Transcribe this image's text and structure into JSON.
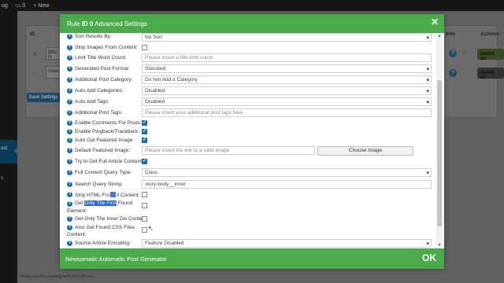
{
  "adminbar": {
    "left_label": "og",
    "comments_count": "0",
    "new_label": "+ New"
  },
  "sidebar": {
    "active_label": "ost",
    "second_label": "s"
  },
  "background": {
    "col_id": "ID",
    "col_info": "Info",
    "col_actions": "Actions",
    "row1_id": "0",
    "row1_value": "BBC N",
    "row2_id": "-",
    "row2_value": "Selec",
    "save_button": "Save Settings",
    "select_button_1": "Select an",
    "select_button_2": "Select an",
    "footer_text": "Thank you for creating with WordPress."
  },
  "modal": {
    "title_prefix": "Rule",
    "title_id": "ID 0",
    "title_suffix": "Advanced Settings",
    "close_icon": "close-icon",
    "footer_title": "Newsomatic Automatic Post Generator",
    "ok_label": "OK",
    "help_glyph": "?"
  },
  "fields": {
    "sort_results_label": "Sort Results By:",
    "sort_results_value": "No Sort",
    "strip_images_label": "Strip Images From Content:",
    "limit_title_label": "Limit Title Word Count:",
    "limit_title_placeholder": "Please insert a title limit count",
    "post_format_label": "Generated Post Format:",
    "post_format_value": "Standard",
    "additional_category_label": "Additional Post Category:",
    "additional_category_value": "Do Not Add a Category",
    "auto_categories_label": "Auto Add Categories:",
    "auto_categories_value": "Disabled",
    "auto_tags_label": "Auto Add Tags:",
    "auto_tags_value": "Disabled",
    "additional_tags_label": "Additional Post Tags:",
    "additional_tags_placeholder": "Please insert your additional post tags here",
    "enable_comments_label": "Enable Comments For Posts:",
    "enable_pingback_label": "Enable Pingback/Trackback:",
    "featured_image_label": "Auto Get Featured Image:",
    "default_featured_label": "Default Featured Image:",
    "default_featured_placeholder": "Please insert the link to a valid image",
    "choose_image_button": "Choose image",
    "full_article_label": "Try to Get Full Article Content:",
    "query_type_label": "Full Content Query Type:",
    "query_type_value": "Class",
    "search_query_label": "Search Query String:",
    "search_query_value": "story-body__inner",
    "strip_html_label_a": "Strip HTML Fro",
    "strip_html_label_b": "ll Content:",
    "get_only_first_prefix": "Get",
    "get_only_first_highlight": "Only The First",
    "get_only_first_suffix": "Found",
    "get_only_first_line2": "Element:",
    "inner_div_label": "Get Only The Inner Div Content:",
    "css_files_label_line1": "Also Get Found CSS Files",
    "css_files_label_line2": "Content:",
    "source_encoding_label": "Source Article Encoding:",
    "source_encoding_value": "Feature Disabled"
  },
  "colors": {
    "header_green": "#4bab4b",
    "help_blue": "#1d6fa3",
    "highlight_blue": "#2866d6"
  }
}
